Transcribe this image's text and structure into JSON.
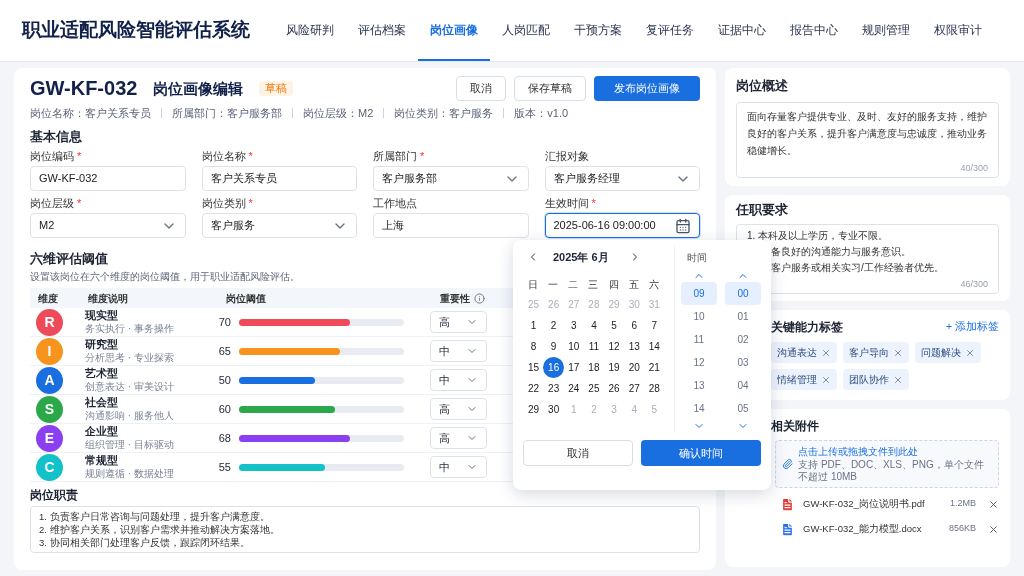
{
  "app_title": "职业适配风险智能评估系统",
  "nav": [
    {
      "label": "风险研判",
      "selected": false
    },
    {
      "label": "评估档案",
      "selected": false
    },
    {
      "label": "岗位画像",
      "selected": true
    },
    {
      "label": "人岗匹配",
      "selected": false
    },
    {
      "label": "干预方案",
      "selected": false
    },
    {
      "label": "复评任务",
      "selected": false
    },
    {
      "label": "证据中心",
      "selected": false
    },
    {
      "label": "报告中心",
      "selected": false
    },
    {
      "label": "规则管理",
      "selected": false
    },
    {
      "label": "权限审计",
      "selected": false
    }
  ],
  "editor": {
    "code": "GW-KF-032",
    "title": "岗位画像编辑",
    "status": "草稿",
    "actions": [
      {
        "label": "取消",
        "kind": "secondary"
      },
      {
        "label": "保存草稿",
        "kind": "secondary"
      },
      {
        "label": "发布岗位画像",
        "kind": "primary"
      }
    ],
    "meta": [
      "岗位名称：客户关系专员",
      "所属部门：客户服务部",
      "岗位层级：M2",
      "岗位类别：客户服务",
      "版本：v1.0"
    ],
    "basic_title": "基本信息",
    "fields": [
      {
        "label": "岗位编码",
        "required_mark": "*",
        "value": "GW-KF-032",
        "kind": "text",
        "focused": false
      },
      {
        "label": "岗位名称",
        "required_mark": "*",
        "value": "客户关系专员",
        "kind": "text",
        "focused": false
      },
      {
        "label": "所属部门",
        "required_mark": "*",
        "value": "客户服务部",
        "kind": "select",
        "focused": false
      },
      {
        "label": "汇报对象",
        "value": "客户服务经理",
        "kind": "select",
        "focused": false
      },
      {
        "label": "岗位层级",
        "required_mark": "*",
        "value": "M2",
        "kind": "select",
        "focused": false
      },
      {
        "label": "岗位类别",
        "required_mark": "*",
        "value": "客户服务",
        "kind": "select",
        "focused": false
      },
      {
        "label": "工作地点",
        "value": "上海",
        "kind": "text",
        "focused": false
      },
      {
        "label": "生效时间",
        "required_mark": "*",
        "value": "2025-06-16 09:00:00",
        "kind": "date",
        "focused": true
      }
    ],
    "dims_title": "六维评估阈值",
    "dims_desc": "设置该岗位在六个维度的岗位阈值，用于职业适配风险评估。",
    "table": {
      "columns": [
        "维度",
        "维度说明",
        "岗位阈值",
        "重要性"
      ],
      "rows": [
        {
          "letter": "R",
          "color": "#ef4a5a",
          "name": "现实型",
          "desc": "务实执行 · 事务操作",
          "value": "70",
          "level": 0.67,
          "importance": "高"
        },
        {
          "letter": "I",
          "color": "#f7941d",
          "name": "研究型",
          "desc": "分析思考 · 专业探索",
          "value": "65",
          "level": 0.61,
          "importance": "中"
        },
        {
          "letter": "A",
          "color": "#1a6fe0",
          "name": "艺术型",
          "desc": "创意表达 · 审美设计",
          "value": "50",
          "level": 0.46,
          "importance": "中"
        },
        {
          "letter": "S",
          "color": "#2aa84a",
          "name": "社会型",
          "desc": "沟通影响 · 服务他人",
          "value": "60",
          "level": 0.58,
          "importance": "高"
        },
        {
          "letter": "E",
          "color": "#8a3ff0",
          "name": "企业型",
          "desc": "组织管理 · 目标驱动",
          "value": "68",
          "level": 0.67,
          "importance": "高"
        },
        {
          "letter": "C",
          "color": "#12c2c8",
          "name": "常规型",
          "desc": "规则遵循 · 数据处理",
          "value": "55",
          "level": 0.52,
          "importance": "中"
        }
      ]
    },
    "duties_title": "岗位职责",
    "duties": [
      "1. 负责客户日常咨询与问题处理，提升客户满意度。",
      "2. 维护客户关系，识别客户需求并推动解决方案落地。",
      "3. 协同相关部门处理客户反馈，跟踪闭环结果。"
    ]
  },
  "overview": {
    "title": "岗位概述",
    "text": "面向存量客户提供专业、及时、友好的服务支持，维护良好的客户关系，提升客户满意度与忠诚度，推动业务稳健增长。",
    "count": "40/300"
  },
  "requirements": {
    "title": "任职要求",
    "lines": [
      "1. 本科及以上学历，专业不限。",
      "备良好的沟通能力与服务意识。",
      "客户服务或相关实习/工作经验者优先。"
    ],
    "count": "46/300"
  },
  "skills": {
    "title": "关键能力标签",
    "add": "+ 添加标签",
    "tags": [
      "沟通表达",
      "客户导向",
      "问题解决",
      "情绪管理",
      "团队协作"
    ]
  },
  "attachments": {
    "title": "相关附件",
    "upload": "点击上传或拖拽文件到此处",
    "hint": "支持 PDF、DOC、XLS、PNG，单个文件不超过 10MB",
    "files": [
      {
        "name": "GW-KF-032_岗位说明书.pdf",
        "size": "1.2MB",
        "kind": "pdf"
      },
      {
        "name": "GW-KF-032_能力模型.docx",
        "size": "856KB",
        "kind": "doc"
      }
    ]
  },
  "picker": {
    "month": "2025年 6月",
    "weekdays": [
      "日",
      "一",
      "二",
      "三",
      "四",
      "五",
      "六"
    ],
    "days": [
      {
        "d": "25",
        "other": true,
        "selected": false
      },
      {
        "d": "26",
        "other": true,
        "selected": false
      },
      {
        "d": "27",
        "other": true,
        "selected": false
      },
      {
        "d": "28",
        "other": true,
        "selected": false
      },
      {
        "d": "29",
        "other": true,
        "selected": false
      },
      {
        "d": "30",
        "other": true,
        "selected": false
      },
      {
        "d": "31",
        "other": true,
        "selected": false
      },
      {
        "d": "1",
        "other": false,
        "selected": false
      },
      {
        "d": "2",
        "other": false,
        "selected": false
      },
      {
        "d": "3",
        "other": false,
        "selected": false
      },
      {
        "d": "4",
        "other": false,
        "selected": false
      },
      {
        "d": "5",
        "other": false,
        "selected": false
      },
      {
        "d": "6",
        "other": false,
        "selected": false
      },
      {
        "d": "7",
        "other": false,
        "selected": false
      },
      {
        "d": "8",
        "other": false,
        "selected": false
      },
      {
        "d": "9",
        "other": false,
        "selected": false
      },
      {
        "d": "10",
        "other": false,
        "selected": false
      },
      {
        "d": "11",
        "other": false,
        "selected": false
      },
      {
        "d": "12",
        "other": false,
        "selected": false
      },
      {
        "d": "13",
        "other": false,
        "selected": false
      },
      {
        "d": "14",
        "other": false,
        "selected": false
      },
      {
        "d": "15",
        "other": false,
        "selected": false
      },
      {
        "d": "16",
        "other": false,
        "selected": true
      },
      {
        "d": "17",
        "other": false,
        "selected": false
      },
      {
        "d": "18",
        "other": false,
        "selected": false
      },
      {
        "d": "19",
        "other": false,
        "selected": false
      },
      {
        "d": "20",
        "other": false,
        "selected": false
      },
      {
        "d": "21",
        "other": false,
        "selected": false
      },
      {
        "d": "22",
        "other": false,
        "selected": false
      },
      {
        "d": "23",
        "other": false,
        "selected": false
      },
      {
        "d": "24",
        "other": false,
        "selected": false
      },
      {
        "d": "25",
        "other": false,
        "selected": false
      },
      {
        "d": "26",
        "other": false,
        "selected": false
      },
      {
        "d": "27",
        "other": false,
        "selected": false
      },
      {
        "d": "28",
        "other": false,
        "selected": false
      },
      {
        "d": "29",
        "other": false,
        "selected": false
      },
      {
        "d": "30",
        "other": false,
        "selected": false
      },
      {
        "d": "1",
        "other": true,
        "selected": false
      },
      {
        "d": "2",
        "other": true,
        "selected": false
      },
      {
        "d": "3",
        "other": true,
        "selected": false
      },
      {
        "d": "4",
        "other": true,
        "selected": false
      },
      {
        "d": "5",
        "other": true,
        "selected": false
      }
    ],
    "time_label": "时间",
    "hours": [
      {
        "v": "09",
        "selected": true
      },
      {
        "v": "10",
        "selected": false
      },
      {
        "v": "11",
        "selected": false
      },
      {
        "v": "12",
        "selected": false
      },
      {
        "v": "13",
        "selected": false
      },
      {
        "v": "14",
        "selected": false
      }
    ],
    "minutes": [
      {
        "v": "00",
        "selected": true
      },
      {
        "v": "01",
        "selected": false
      },
      {
        "v": "02",
        "selected": false
      },
      {
        "v": "03",
        "selected": false
      },
      {
        "v": "04",
        "selected": false
      },
      {
        "v": "05",
        "selected": false
      }
    ],
    "cancel": "取消",
    "confirm": "确认时间"
  }
}
